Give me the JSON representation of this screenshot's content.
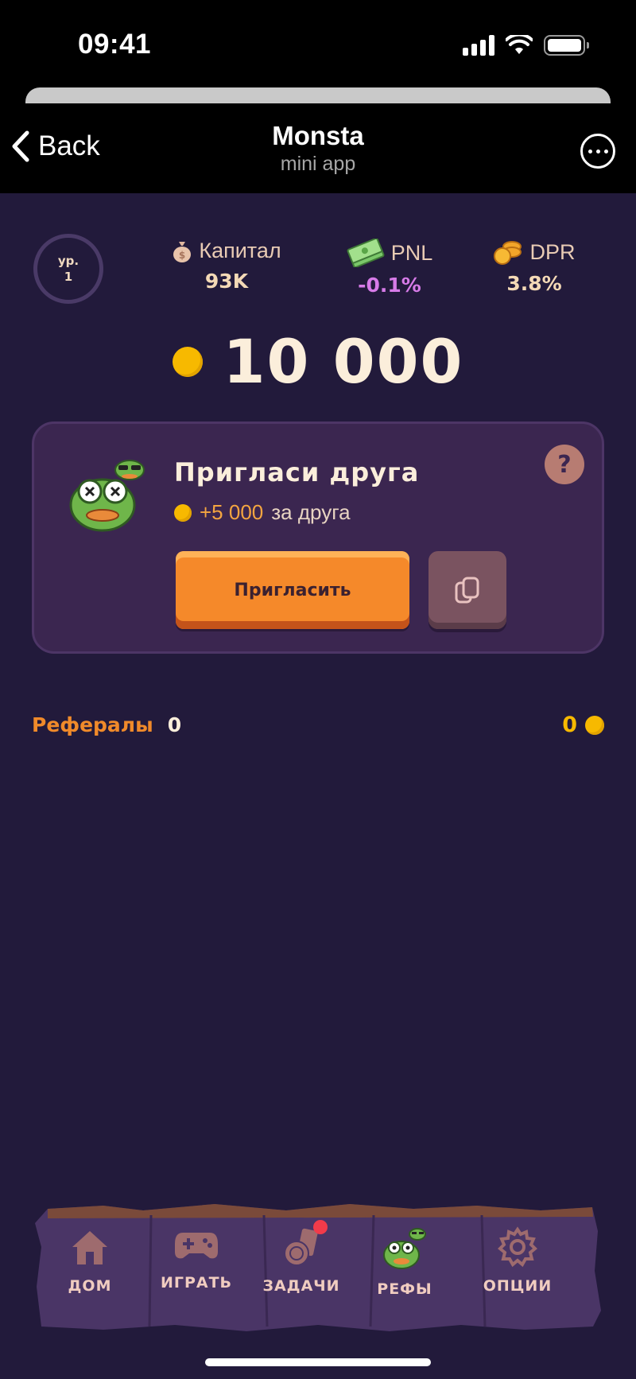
{
  "status_bar": {
    "time": "09:41"
  },
  "header": {
    "back_label": "Back",
    "title": "Monsta",
    "subtitle": "mini app"
  },
  "level": {
    "prefix": "ур.",
    "value": "1"
  },
  "stats": {
    "capital": {
      "label": "Капитал",
      "value": "93K",
      "color": "#f4d9b6",
      "icon": "money-bag-icon"
    },
    "pnl": {
      "label": "PNL",
      "value": "-0.1%",
      "color": "#d77be8",
      "icon": "cash-stack-icon"
    },
    "dpr": {
      "label": "DPR",
      "value": "3.8%",
      "color": "#f4d9b6",
      "icon": "coins-stack-icon"
    }
  },
  "balance": {
    "value": "10 000",
    "icon": "coin-icon"
  },
  "invite": {
    "title": "Пригласи друга",
    "reward_amount": "+5 000",
    "reward_suffix": "за друга",
    "invite_button": "Пригласить",
    "help_label": "?"
  },
  "referrals": {
    "label": "Рефералы",
    "count": "0",
    "earned": "0"
  },
  "nav": {
    "items": [
      {
        "label": "ДОМ",
        "icon": "home-icon"
      },
      {
        "label": "ИГРАТЬ",
        "icon": "gamepad-icon"
      },
      {
        "label": "ЗАДАЧИ",
        "icon": "tasks-icon"
      },
      {
        "label": "РЕФЫ",
        "icon": "frog-icon"
      },
      {
        "label": "ОПЦИИ",
        "icon": "gear-icon"
      }
    ]
  },
  "colors": {
    "background": "#221a3b",
    "accent_orange": "#f5892a",
    "coin": "#f7b900",
    "card": "#3b2650"
  }
}
